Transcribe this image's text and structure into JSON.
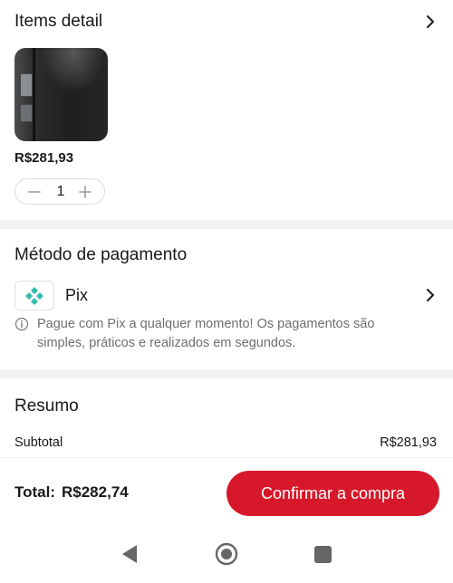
{
  "items": {
    "title": "Items detail",
    "price": "R$281,93",
    "quantity": "1"
  },
  "payment": {
    "title": "Método de pagamento",
    "method": "Pix",
    "info": "Pague com Pix a qualquer momento! Os pagamentos são simples, práticos e realizados em segundos.",
    "pix_color": "#32bcad"
  },
  "summary": {
    "title": "Resumo",
    "subtotal_label": "Subtotal",
    "subtotal_value": "R$281,93"
  },
  "footer": {
    "total_label": "Total:",
    "total_value": "R$282,74",
    "confirm_label": "Confirmar a compra",
    "accent": "#d7182a"
  },
  "icons": {
    "chevron": "chevron-right-icon",
    "minus": "minus-icon",
    "plus": "plus-icon",
    "info": "info-icon",
    "pix": "pix-logo-icon"
  }
}
